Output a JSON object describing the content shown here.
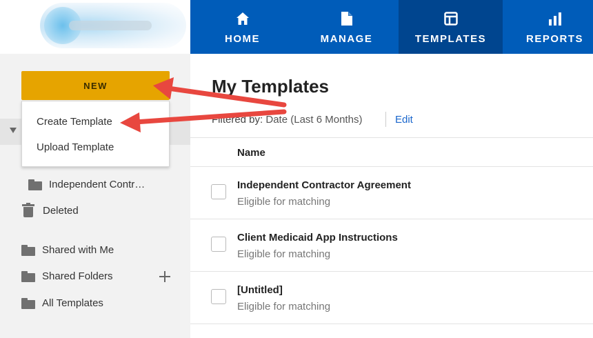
{
  "nav": {
    "items": [
      {
        "label": "HOME",
        "icon": "home-icon"
      },
      {
        "label": "MANAGE",
        "icon": "document-icon"
      },
      {
        "label": "TEMPLATES",
        "icon": "template-icon",
        "active": true
      },
      {
        "label": "REPORTS",
        "icon": "bar-chart-icon"
      }
    ]
  },
  "sidebar": {
    "new_label": "NEW",
    "dropdown": [
      "Create Template",
      "Upload Template"
    ],
    "items": [
      {
        "label": "Independent Contr…",
        "icon": "folder-icon"
      },
      {
        "label": "Deleted",
        "icon": "trash-icon"
      },
      {
        "label": "Shared with Me",
        "icon": "folder-icon"
      },
      {
        "label": "Shared Folders",
        "icon": "folder-icon"
      },
      {
        "label": "All Templates",
        "icon": "folder-icon"
      }
    ]
  },
  "main": {
    "title": "My Templates",
    "filter_label": "Filtered by:",
    "filter_value": "Date (Last 6 Months)",
    "edit_label": "Edit",
    "column_name": "Name",
    "rows": [
      {
        "title": "Independent Contractor Agreement",
        "status": "Eligible for matching"
      },
      {
        "title": "Client Medicaid App Instructions",
        "status": "Eligible for matching"
      },
      {
        "title": "[Untitled]",
        "status": "Eligible for matching"
      }
    ]
  },
  "colors": {
    "nav_bg": "#005cb9",
    "nav_active": "#00458f",
    "new_button": "#e6a400",
    "annotation_arrow": "#e8473f",
    "link": "#1a66cc"
  }
}
